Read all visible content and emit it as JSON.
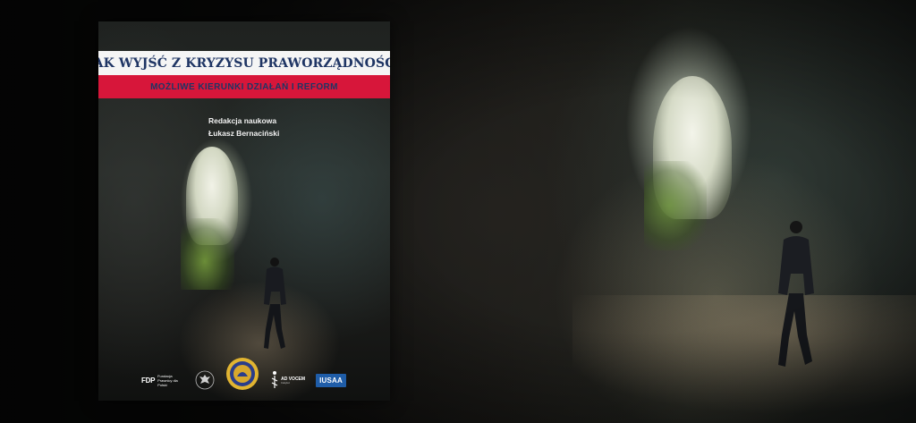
{
  "cover": {
    "title": "JAK WYJŚĆ Z KRYZYSU PRAWORZĄDNOŚCI",
    "subtitle": "MOŻLIWE KIERUNKI DZIAŁAŃ I REFORM",
    "editor_role": "Redakcja naukowa",
    "editor_name": "Łukasz Bernaciński",
    "colors": {
      "band_white": "#f5f5f5",
      "band_red": "#d7163a",
      "title_text": "#1f3564"
    },
    "logos": {
      "fdp_mark": "FDP",
      "fdp_text": "Fundacja Prawnicy dla Polski",
      "advocem_name": "AD VOCEM",
      "advocem_sub": "Instytut",
      "iusaa": "IUSAA"
    }
  },
  "icons": [
    "fdp-logo-icon",
    "eagle-emblem-icon",
    "university-seal-icon",
    "advocem-logo-icon",
    "iusaa-logo-icon",
    "walking-man-icon"
  ]
}
